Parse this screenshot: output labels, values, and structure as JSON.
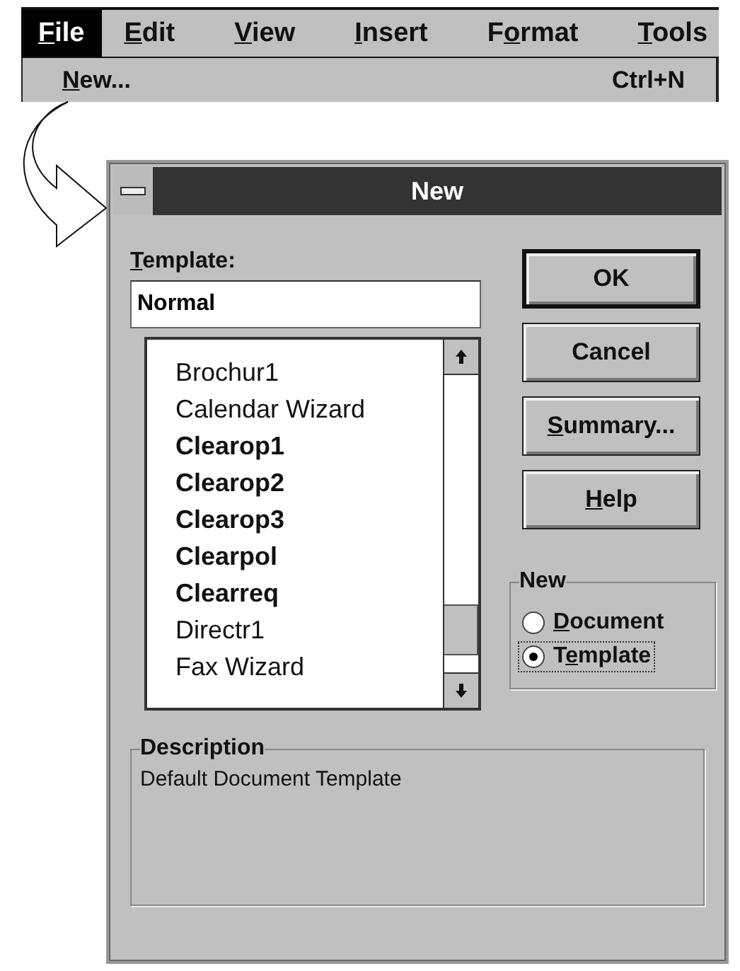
{
  "menu_bar": {
    "items": [
      {
        "label": {
          "key": "F",
          "post": "ile"
        },
        "selected": true
      },
      {
        "label": {
          "key": "E",
          "post": "dit"
        },
        "selected": false
      },
      {
        "label": {
          "key": "V",
          "post": "iew"
        },
        "selected": false
      },
      {
        "label": {
          "key": "I",
          "post": "nsert"
        },
        "selected": false
      },
      {
        "label": {
          "pre": "F",
          "key": "o",
          "post": "rmat"
        },
        "selected": false
      },
      {
        "label": {
          "key": "T",
          "post": "ools"
        },
        "selected": false
      }
    ]
  },
  "menu": {
    "items": [
      {
        "label": {
          "key": "N",
          "post": "ew..."
        },
        "shortcut": "Ctrl+N"
      }
    ]
  },
  "dialog": {
    "title": "New",
    "template_label": {
      "key": "T",
      "post": "emplate:"
    },
    "template_value": "Normal",
    "templates": [
      {
        "name": "Brochur1",
        "bold": false
      },
      {
        "name": "Calendar Wizard",
        "bold": false
      },
      {
        "name": "Clearop1",
        "bold": true
      },
      {
        "name": "Clearop2",
        "bold": true
      },
      {
        "name": "Clearop3",
        "bold": true
      },
      {
        "name": "Clearpol",
        "bold": true
      },
      {
        "name": "Clearreq",
        "bold": true
      },
      {
        "name": "Directr1",
        "bold": false
      },
      {
        "name": "Fax Wizard",
        "bold": false
      }
    ],
    "buttons": [
      {
        "label": {
          "post": "OK"
        },
        "default": true
      },
      {
        "label": {
          "post": "Cancel"
        },
        "default": false
      },
      {
        "label": {
          "key": "S",
          "post": "ummary..."
        },
        "default": false
      },
      {
        "label": {
          "key": "H",
          "post": "elp"
        },
        "default": false
      }
    ],
    "new_group": {
      "title": "New",
      "options": [
        {
          "label": {
            "key": "D",
            "post": "ocument"
          },
          "selected": false,
          "focused": false
        },
        {
          "label": {
            "pre": "T",
            "key": "e",
            "post": "mplate"
          },
          "selected": true,
          "focused": true
        }
      ]
    },
    "description": {
      "title": "Description",
      "text": "Default Document Template"
    }
  }
}
